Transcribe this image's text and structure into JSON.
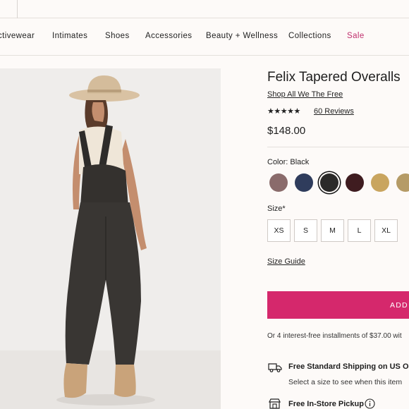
{
  "nav": {
    "items": [
      "ctivewear",
      "Intimates",
      "Shoes",
      "Accessories",
      "Beauty + Wellness",
      "Collections",
      "Sale"
    ]
  },
  "product": {
    "title": "Felix Tapered Overalls",
    "brand_link": "Shop All We The Free",
    "stars": "★★★★★",
    "rating": 4.5,
    "reviews": "60 Reviews",
    "price": "$148.00"
  },
  "color": {
    "label": "Color: Black",
    "swatches": [
      {
        "name": "mauve",
        "hex": "#8a6b6b"
      },
      {
        "name": "navy",
        "hex": "#2f3c5c"
      },
      {
        "name": "black",
        "hex": "#2b2a29",
        "selected": true
      },
      {
        "name": "burgundy",
        "hex": "#3f1c20"
      },
      {
        "name": "gold",
        "hex": "#c9a55f"
      },
      {
        "name": "khaki",
        "hex": "#b59b66"
      }
    ]
  },
  "size": {
    "label": "Size*",
    "options": [
      "XS",
      "S",
      "M",
      "L",
      "XL"
    ],
    "guide": "Size Guide"
  },
  "cart": {
    "add_label": "ADD"
  },
  "installments": "Or 4 interest-free installments of $37.00 wit",
  "shipping": {
    "title": "Free Standard Shipping on US Or",
    "subtitle": "Select a size to see when this item",
    "pickup": "Free In-Store Pickup"
  },
  "icons": {
    "shipping": "truck-icon",
    "store": "store-icon",
    "info": "info-icon"
  },
  "colors": {
    "accent": "#d5286c",
    "sale": "#c0306e"
  }
}
